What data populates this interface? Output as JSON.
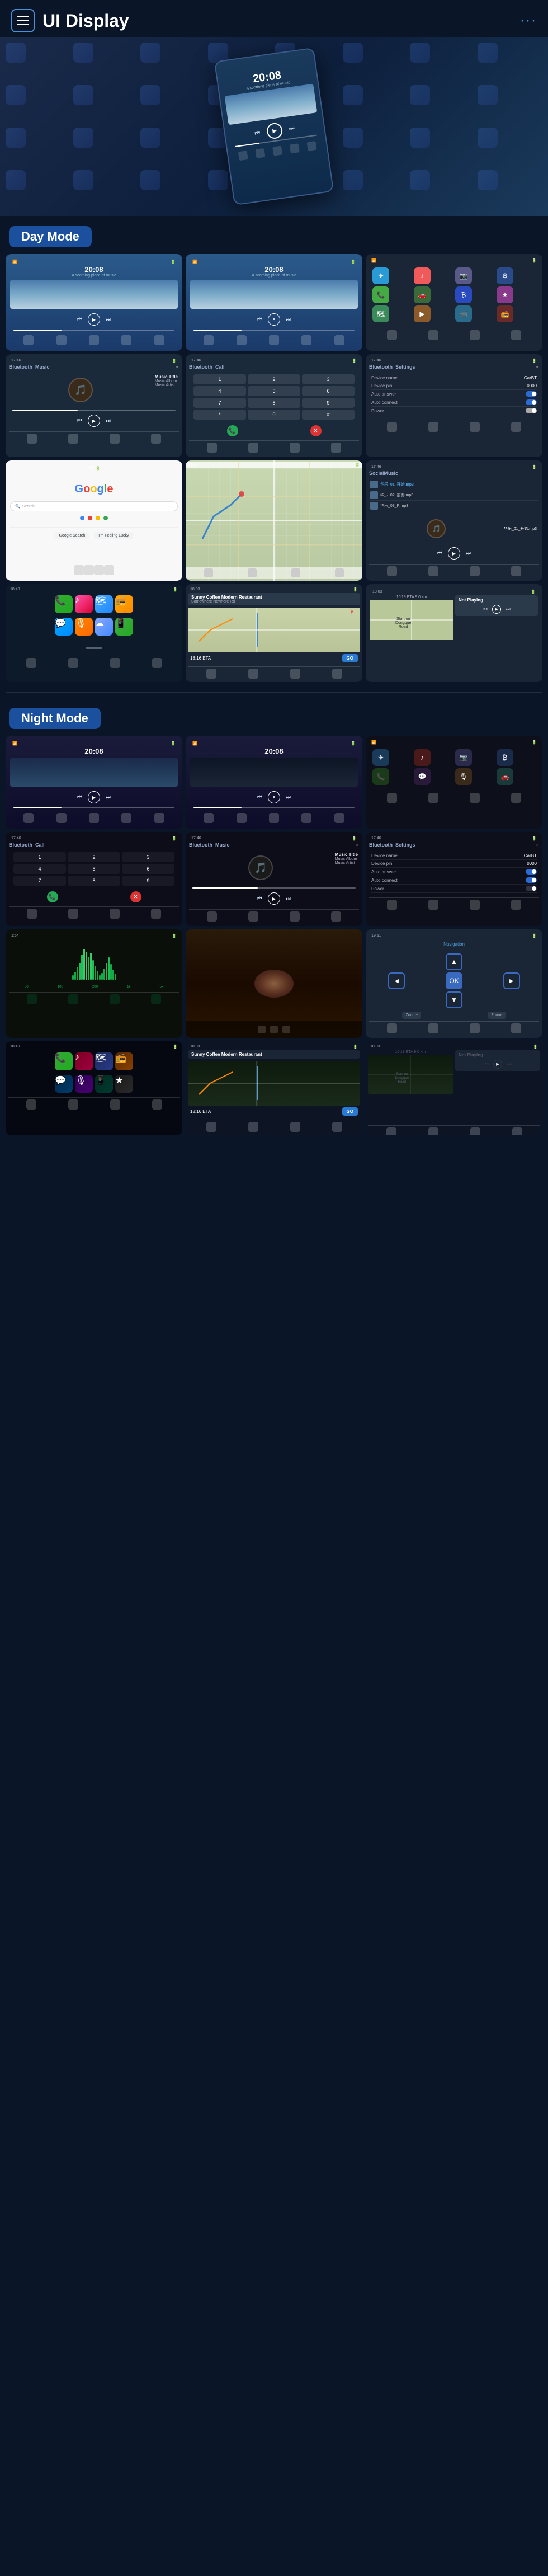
{
  "header": {
    "title": "UI Display",
    "menu_label": "≡",
    "nav_dots": "···"
  },
  "day_mode": {
    "label": "Day Mode",
    "screens": [
      {
        "id": "day-music-1",
        "type": "music",
        "time": "20:08",
        "subtitle": "A soothing piece of music"
      },
      {
        "id": "day-music-2",
        "type": "music",
        "time": "20:08",
        "subtitle": "A soothing piece of music"
      },
      {
        "id": "day-apps",
        "type": "apps"
      },
      {
        "id": "day-bt-music",
        "type": "bluetooth_music",
        "title": "Bluetooth_Music",
        "music_title": "Music Title",
        "music_album": "Music Album",
        "music_artist": "Music Artist"
      },
      {
        "id": "day-bt-call",
        "type": "bluetooth_call",
        "title": "Bluetooth_Call"
      },
      {
        "id": "day-bt-settings",
        "type": "bluetooth_settings",
        "title": "Bluetooth_Settings",
        "device_name_label": "Device name",
        "device_name_value": "CarBT",
        "device_pin_label": "Device pin",
        "device_pin_value": "0000",
        "auto_answer_label": "Auto answer",
        "auto_connect_label": "Auto connect",
        "power_label": "Power"
      },
      {
        "id": "day-google",
        "type": "google"
      },
      {
        "id": "day-map",
        "type": "map"
      },
      {
        "id": "day-local-music",
        "type": "local_music",
        "title": "SocialMusic",
        "items": [
          "华乐_01_开始.mp3",
          "华乐_02_前奏.mp3",
          "华乐_03_R.mp3"
        ]
      },
      {
        "id": "day-carplay",
        "type": "carplay"
      },
      {
        "id": "day-nav",
        "type": "navigation",
        "place": "Sunny Coffee Modern Restaurant",
        "address": "Somewhere Nowhere Rd",
        "eta": "18:16 ETA",
        "go_label": "GO"
      },
      {
        "id": "day-not-playing",
        "type": "not_playing",
        "distance": "10'19 ETA    9.0 km",
        "not_playing_label": "Not Playing",
        "road": "Dongque Road"
      }
    ]
  },
  "night_mode": {
    "label": "Night Mode",
    "screens": [
      {
        "id": "night-music-1",
        "type": "music_night",
        "time": "20:08"
      },
      {
        "id": "night-music-2",
        "type": "music_night",
        "time": "20:08"
      },
      {
        "id": "night-apps",
        "type": "apps_night"
      },
      {
        "id": "night-bt-call",
        "type": "bluetooth_call_night",
        "title": "Bluetooth_Call"
      },
      {
        "id": "night-bt-music",
        "type": "bluetooth_music_night",
        "title": "Bluetooth_Music",
        "music_title": "Music Title",
        "music_album": "Music Album",
        "music_artist": "Music Artist"
      },
      {
        "id": "night-bt-settings",
        "type": "bluetooth_settings_night",
        "title": "Bluetooth_Settings",
        "device_name_label": "Device name",
        "device_name_value": "CarBT",
        "device_pin_label": "Device pin",
        "device_pin_value": "0000",
        "auto_answer_label": "Auto answer",
        "auto_connect_label": "Auto connect",
        "power_label": "Power"
      },
      {
        "id": "night-waveform",
        "type": "waveform"
      },
      {
        "id": "night-food",
        "type": "food_photo"
      },
      {
        "id": "night-road",
        "type": "road_nav"
      },
      {
        "id": "night-carplay",
        "type": "carplay_night"
      },
      {
        "id": "night-nav",
        "type": "navigation_night",
        "place": "Sunny Coffee Modern Restaurant",
        "eta": "18:16 ETA",
        "go_label": "GO"
      },
      {
        "id": "night-not-playing",
        "type": "not_playing_night",
        "distance": "10'19 ETA    9.0 km",
        "not_playing_label": "Not Playing",
        "road": "Dongque Road"
      }
    ]
  }
}
